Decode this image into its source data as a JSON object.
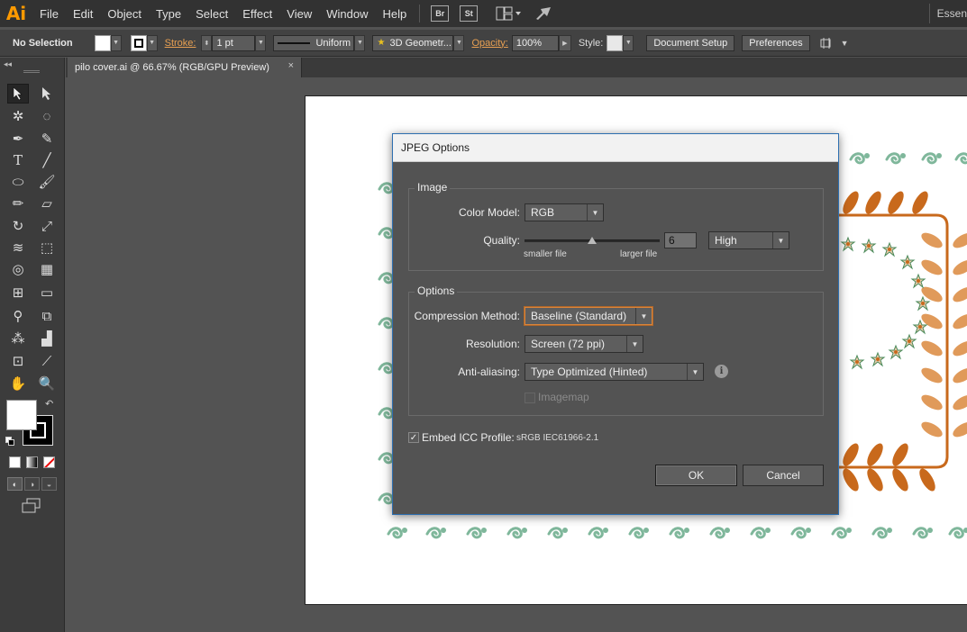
{
  "app": {
    "logo": "Ai",
    "menu": [
      "File",
      "Edit",
      "Object",
      "Type",
      "Select",
      "Effect",
      "View",
      "Window",
      "Help"
    ],
    "bridge_btn": "Br",
    "stock_btn": "St",
    "workspace": "Essen"
  },
  "controlbar": {
    "selection": "No Selection",
    "stroke_label": "Stroke:",
    "stroke_value": "1 pt",
    "profile": "Uniform",
    "brush": "3D Geometr...",
    "opacity_label": "Opacity:",
    "opacity_value": "100%",
    "style_label": "Style:",
    "document_setup": "Document Setup",
    "preferences": "Preferences"
  },
  "document": {
    "tab_title": "pilo cover.ai @ 66.67% (RGB/GPU Preview)",
    "close_glyph": "×"
  },
  "dialog": {
    "title": "JPEG Options",
    "image_group": "Image",
    "color_model_label": "Color Model:",
    "color_model_value": "RGB",
    "quality_label": "Quality:",
    "quality_value": "6",
    "quality_preset": "High",
    "quality_fraction": 0.5,
    "smaller_file": "smaller file",
    "larger_file": "larger file",
    "options_group": "Options",
    "compression_label": "Compression Method:",
    "compression_value": "Baseline (Standard)",
    "resolution_label": "Resolution:",
    "resolution_value": "Screen (72 ppi)",
    "antialias_label": "Anti-aliasing:",
    "antialias_value": "Type Optimized (Hinted)",
    "imagemap_label": "Imagemap",
    "imagemap_checked": false,
    "embed_label": "Embed ICC Profile:",
    "embed_checked": true,
    "embed_profile": "sRGB IEC61966-2.1",
    "ok": "OK",
    "cancel": "Cancel"
  },
  "colors": {
    "accent_orange": "#e8a052",
    "focus_orange": "#d9853b",
    "dialog_border": "#2e6fb0",
    "pattern_green": "#7fb79b",
    "leaf_orange": "#c8691c",
    "leaf_light": "#e09a5a"
  }
}
